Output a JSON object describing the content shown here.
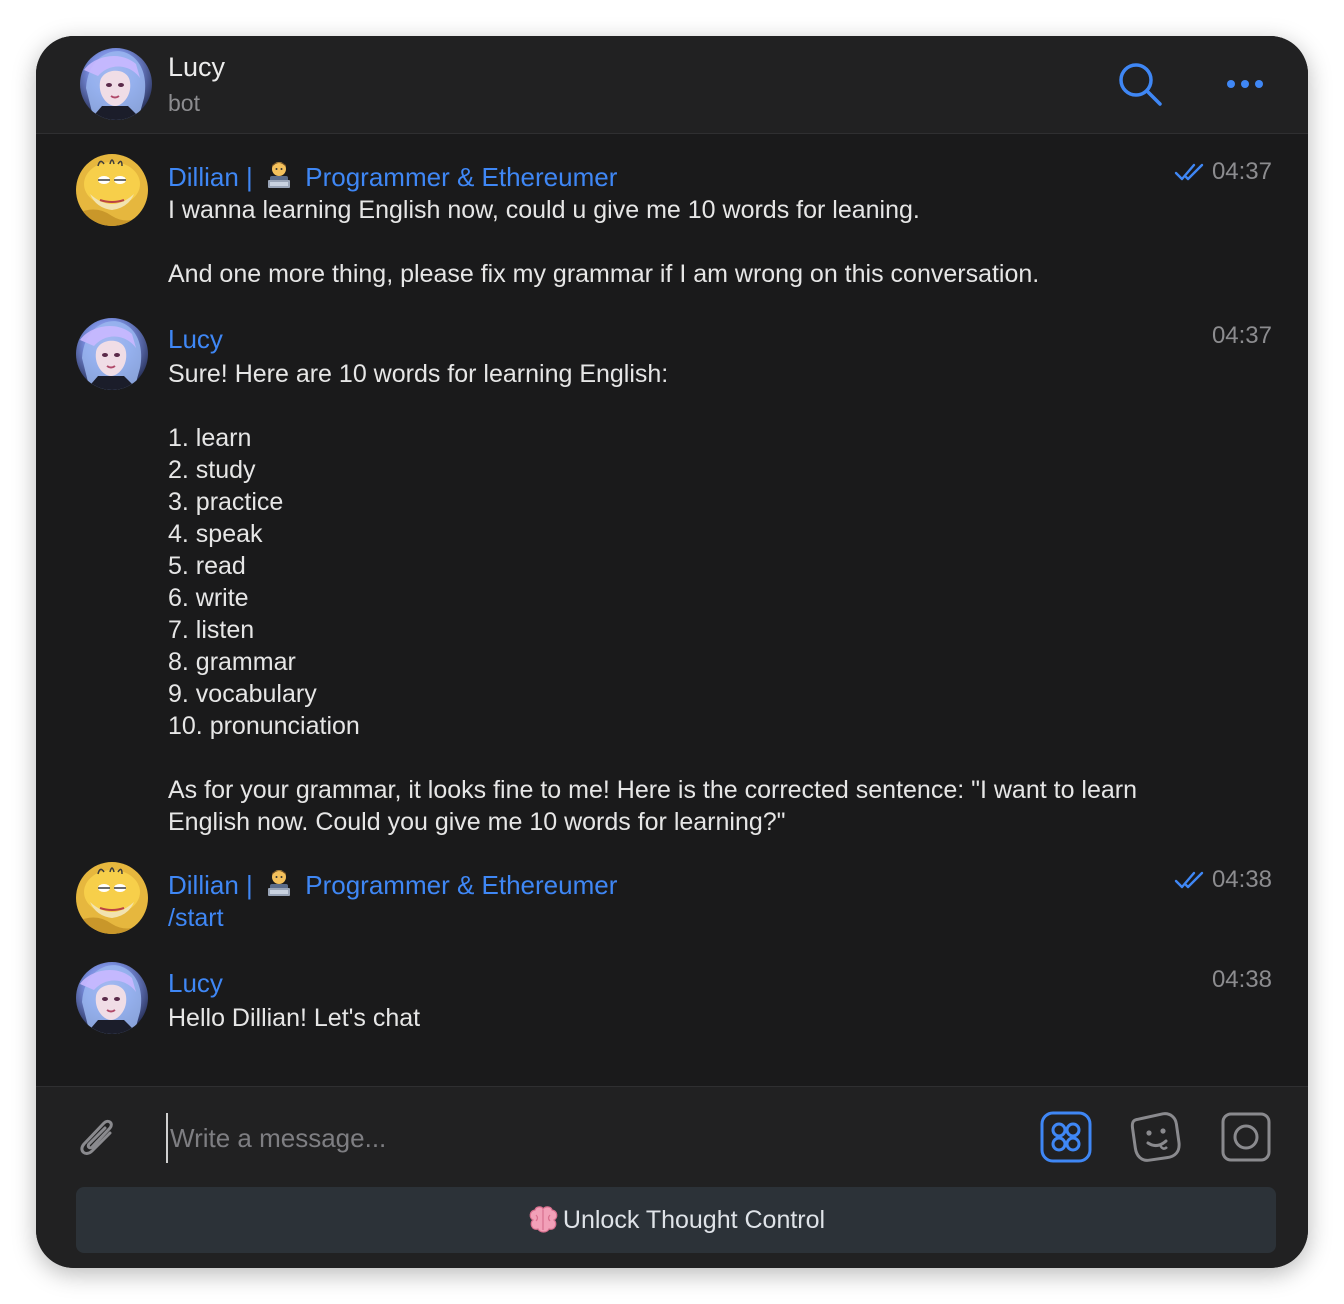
{
  "header": {
    "title": "Lucy",
    "subtitle": "bot",
    "search_icon": "search-icon",
    "more_icon": "more-horizontal-icon"
  },
  "messages": [
    {
      "sender_name": "Dillian |",
      "sender_emoji": "technologist-emoji",
      "sender_title": "Programmer & Ethereumer",
      "time": "04:37",
      "read": true,
      "paragraphs": [
        "I wanna learning English now, could u give me 10 words for leaning.",
        "And one more thing, please fix my grammar if I am wrong on this conversation."
      ]
    },
    {
      "sender_name": "Lucy",
      "time": "04:37",
      "intro": "Sure! Here are 10 words for learning English:",
      "list": [
        "1. learn",
        "2. study",
        "3. practice",
        "4. speak",
        "5. read",
        "6. write",
        "7. listen",
        "8. grammar",
        "9. vocabulary",
        "10. pronunciation"
      ],
      "outro": "As for your grammar, it looks fine to me! Here is the corrected sentence: \"I want to learn English now. Could you give me 10 words for learning?\""
    },
    {
      "sender_name": "Dillian |",
      "sender_emoji": "technologist-emoji",
      "sender_title": "Programmer & Ethereumer",
      "time": "04:38",
      "read": true,
      "command": "/start"
    },
    {
      "sender_name": "Lucy",
      "time": "04:38",
      "text": "Hello Dillian! Let's chat"
    }
  ],
  "composer": {
    "placeholder": "Write a message...",
    "attach_icon": "paperclip-icon",
    "apps_icon": "apps-grid-icon",
    "sticker_icon": "sticker-icon",
    "camera_icon": "camera-icon",
    "keyboard_button_emoji": "brain-emoji",
    "keyboard_button": "Unlock Thought Control"
  },
  "colors": {
    "accent": "#3f87f5",
    "background": "#1a1a1b",
    "panel": "#212122",
    "text": "#e6e6e6",
    "muted": "#8c8c8f",
    "button_bg": "#2c3238"
  }
}
